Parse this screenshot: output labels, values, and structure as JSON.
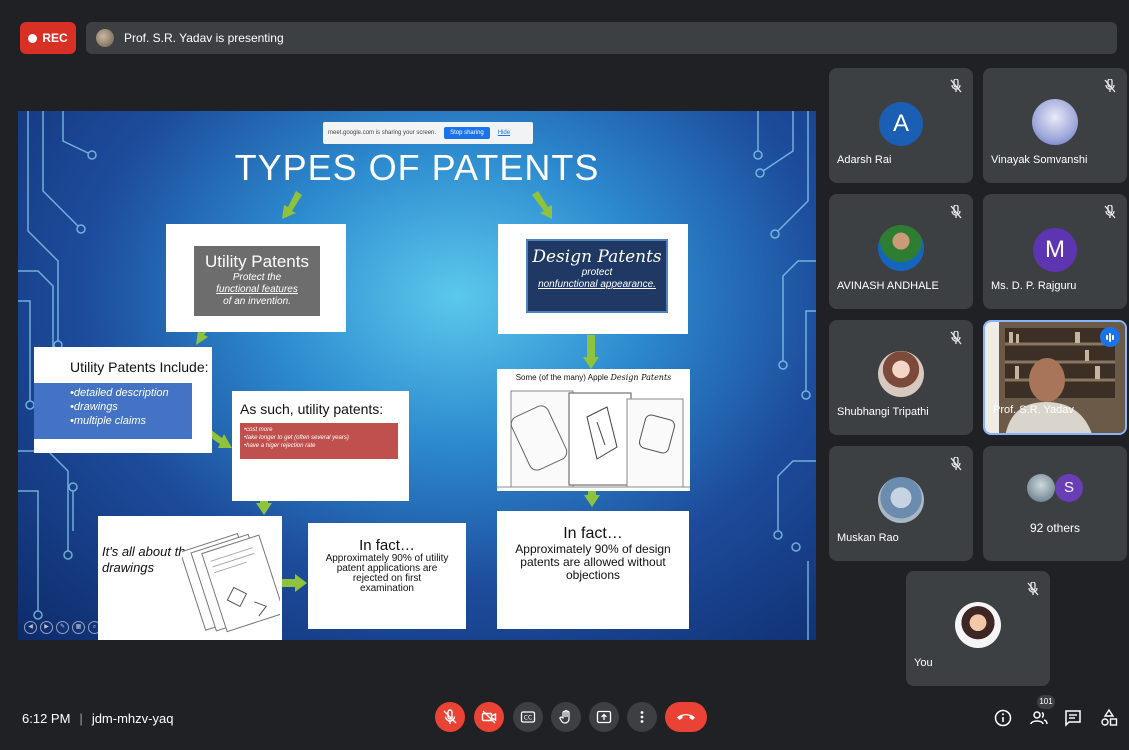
{
  "top": {
    "rec_label": "REC",
    "presenting_text": "Prof. S.R. Yadav is presenting"
  },
  "slide": {
    "share_bar": {
      "text": "meet.google.com is sharing your screen.",
      "stop_label": "Stop sharing",
      "hide_label": "Hide"
    },
    "title": "TYPES OF PATENTS",
    "utility": {
      "title": "Utility Patents",
      "line1": "Protect the",
      "line2": "functional features",
      "line3": "of an invention."
    },
    "design": {
      "title": "Design Patents",
      "line1": "protect",
      "line2": "nonfunctional appearance."
    },
    "include": {
      "title": "Utility Patents Include:",
      "items": [
        "•detailed description",
        "•drawings",
        "•multiple claims"
      ]
    },
    "such": {
      "title": "As such, utility patents:",
      "items": [
        "•cost more",
        "•take longer to get (often several years)",
        "•have a higer rejection rate"
      ]
    },
    "apple_title_plain": "Some (of the many) Apple",
    "apple_title_script": "Design Patents",
    "drawings_line1": "It's all about the",
    "drawings_line2": "drawings",
    "fact1": {
      "title": "In fact…",
      "body1": "Approximately 90% of utility",
      "body2": "patent applications are",
      "body3": "rejected on first",
      "body4": "examination"
    },
    "fact2": {
      "title": "In fact…",
      "body1": "Approximately 90% of design",
      "body2": "patents are allowed without",
      "body3": "objections"
    }
  },
  "participants": [
    {
      "name": "Adarsh Rai",
      "initial": "A",
      "color": "#1a5fb4"
    },
    {
      "name": "Vinayak Somvanshi"
    },
    {
      "name": "AVINASH ANDHALE"
    },
    {
      "name": "Ms. D. P. Rajguru",
      "initial": "M",
      "color": "#5e35b1"
    },
    {
      "name": "Shubhangi Tripathi"
    },
    {
      "name": "Prof. S.R. Yadav"
    },
    {
      "name": "Muskan Rao"
    },
    {
      "name": "92 others",
      "initial": "S",
      "color": "#6a3fb5"
    },
    {
      "name": "You"
    }
  ],
  "bottom": {
    "time": "6:12 PM",
    "meeting_code": "jdm-mhzv-yaq",
    "people_count": "101"
  },
  "colors": {
    "end_call": "#ea4335",
    "mic_off": "#ea4335",
    "background": "#202124",
    "tile": "#3c4043"
  }
}
